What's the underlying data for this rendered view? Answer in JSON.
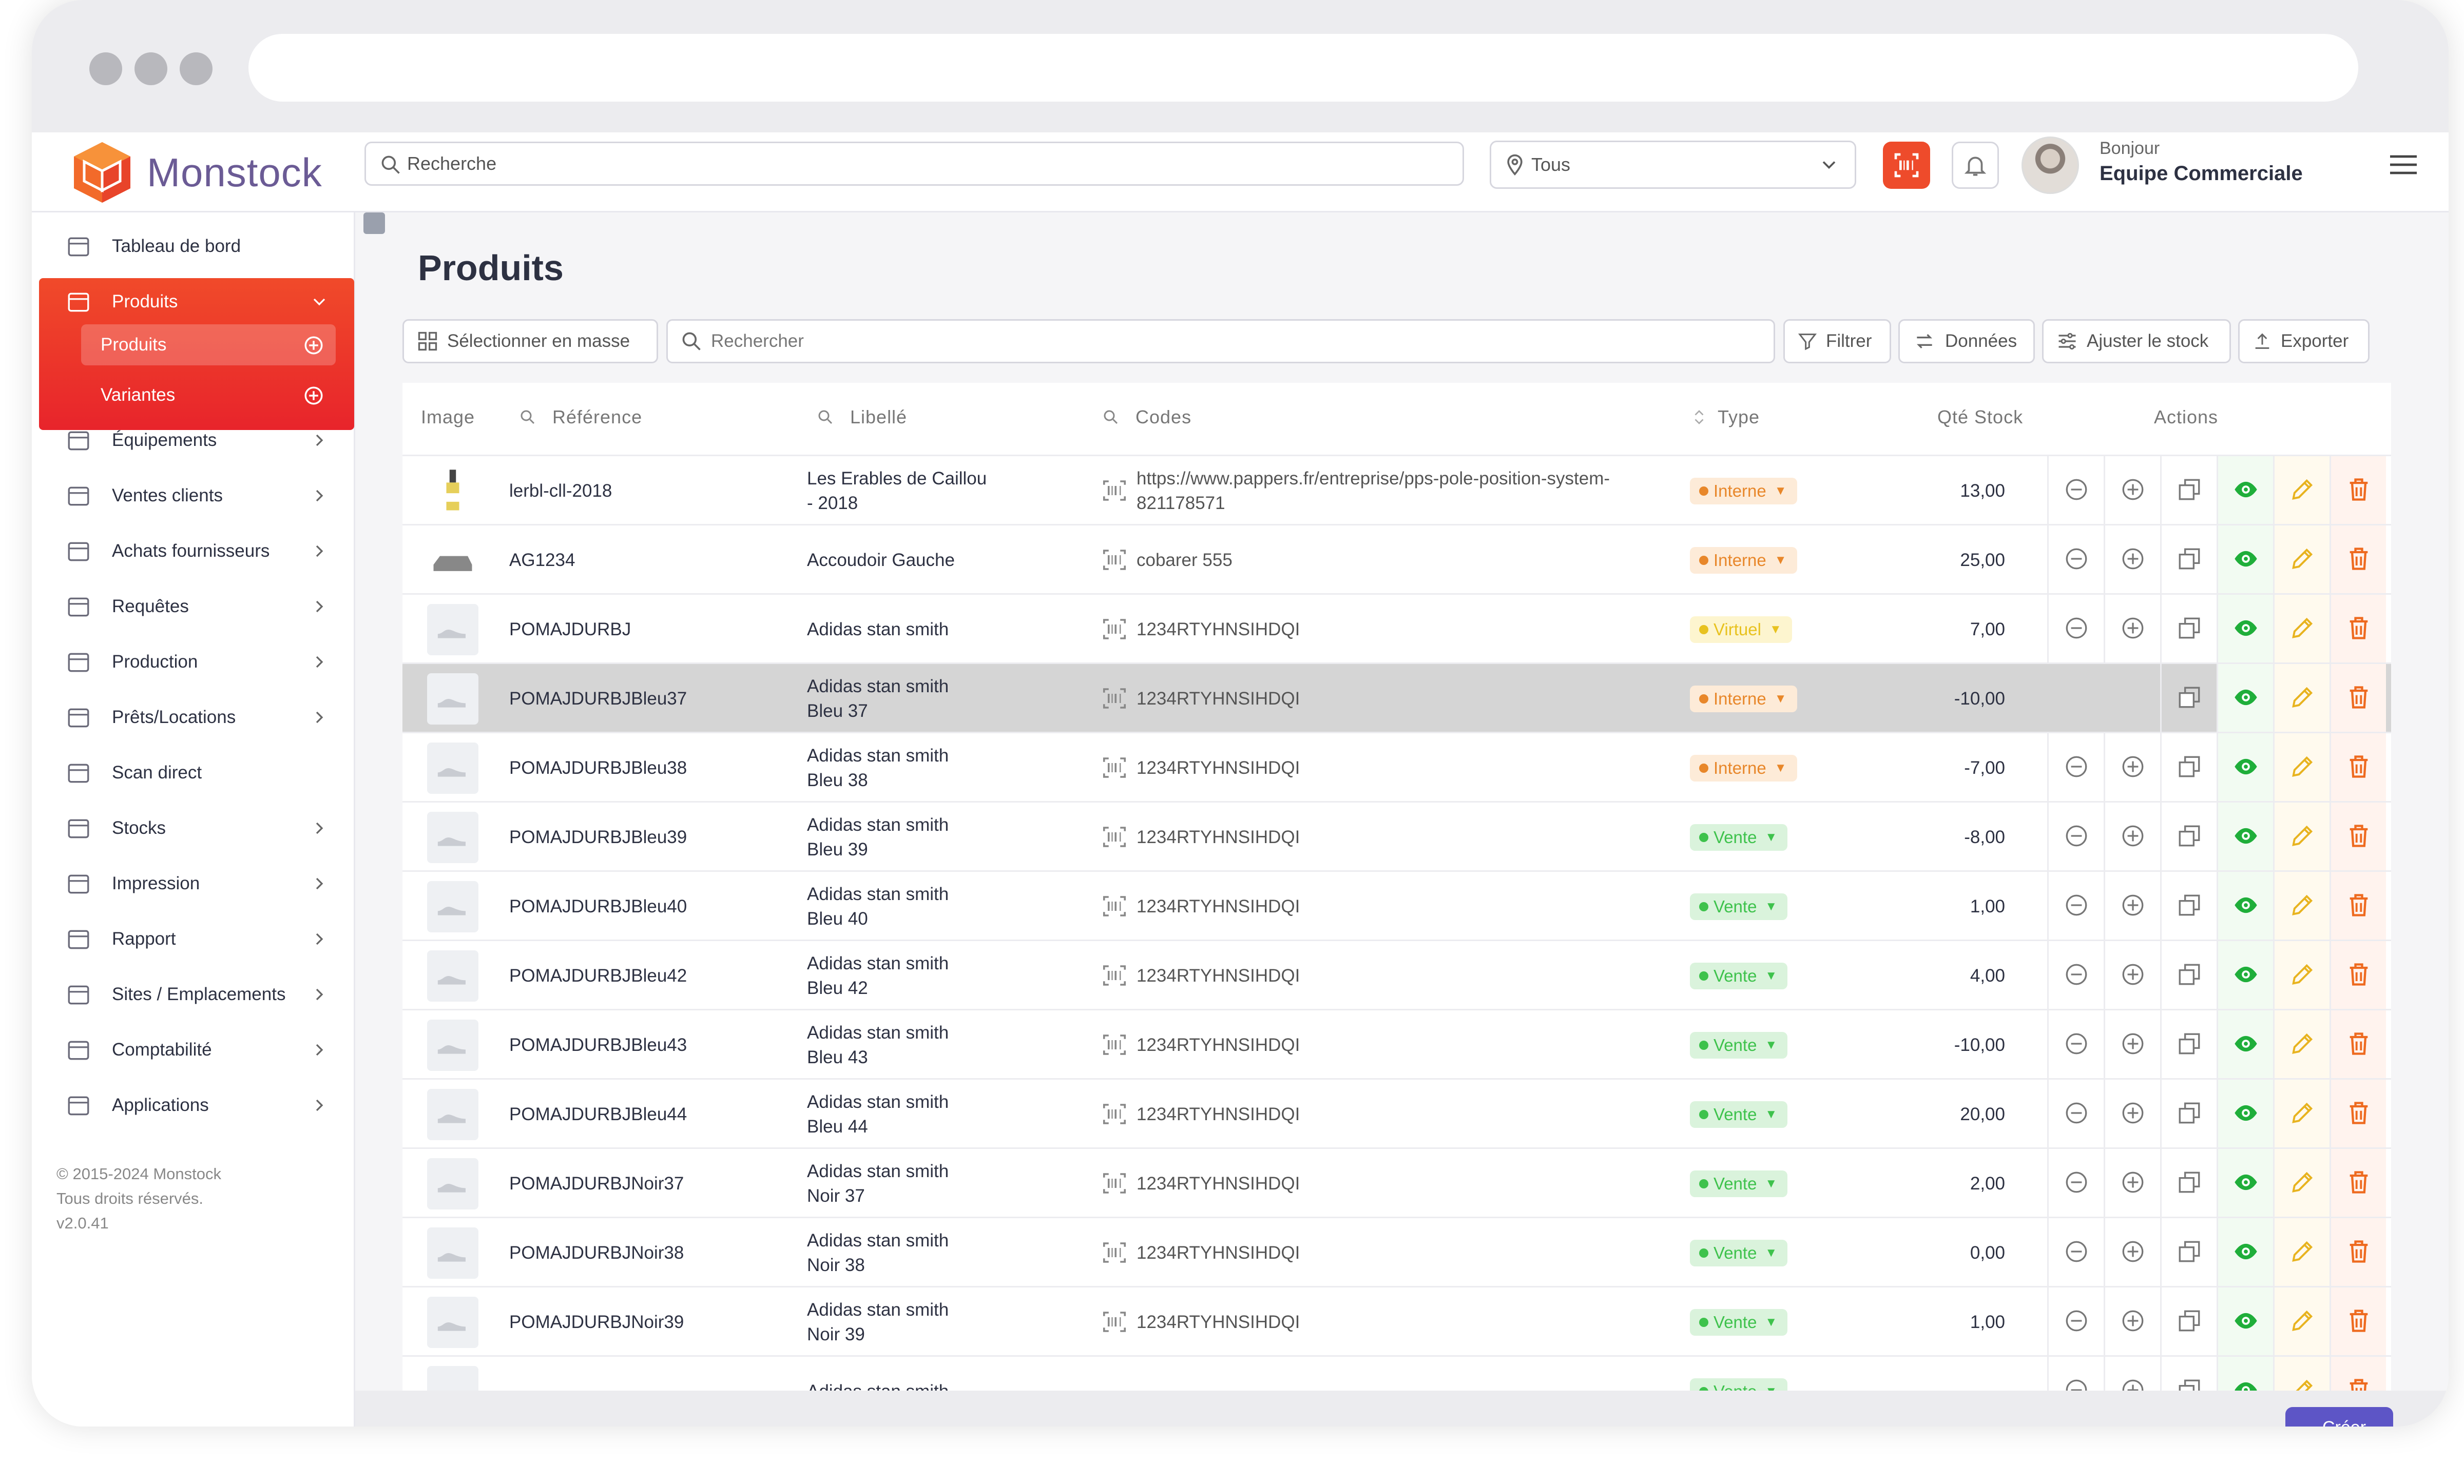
{
  "app": {
    "name": "Monstock"
  },
  "header": {
    "search_placeholder": "Recherche",
    "location_value": "Tous",
    "greeting": "Bonjour",
    "user_name": "Equipe Commerciale"
  },
  "sidebar": {
    "items": [
      {
        "label": "Tableau de bord",
        "icon": "dashboard-icon"
      },
      {
        "label": "Produits",
        "icon": "box-icon"
      },
      {
        "label": "Équipements",
        "icon": "tools-icon"
      },
      {
        "label": "Ventes clients",
        "icon": "sales-icon"
      },
      {
        "label": "Achats fournisseurs",
        "icon": "purchase-icon"
      },
      {
        "label": "Requêtes",
        "icon": "request-icon"
      },
      {
        "label": "Production",
        "icon": "production-icon"
      },
      {
        "label": "Prêts/Locations",
        "icon": "location-icon"
      },
      {
        "label": "Scan direct",
        "icon": "scan-icon"
      },
      {
        "label": "Stocks",
        "icon": "warehouse-icon"
      },
      {
        "label": "Impression",
        "icon": "tag-icon"
      },
      {
        "label": "Rapport",
        "icon": "report-icon"
      },
      {
        "label": "Sites / Emplacements",
        "icon": "site-icon"
      },
      {
        "label": "Comptabilité",
        "icon": "accounting-icon"
      },
      {
        "label": "Applications",
        "icon": "apps-icon"
      }
    ],
    "subitems": [
      {
        "label": "Produits"
      },
      {
        "label": "Variantes"
      }
    ],
    "copyright": [
      "© 2015-2024 Monstock",
      "Tous droits réservés.",
      "v2.0.41"
    ]
  },
  "main": {
    "title": "Produits",
    "toolbar": {
      "select_mass": "Sélectionner en masse",
      "search_placeholder": "Rechercher",
      "filter": "Filtrer",
      "data": "Données",
      "adjust": "Ajuster le stock",
      "export": "Exporter"
    },
    "columns": {
      "image": "Image",
      "reference": "Référence",
      "libelle": "Libellé",
      "codes": "Codes",
      "type": "Type",
      "qty": "Qté Stock",
      "actions": "Actions"
    },
    "rows": [
      {
        "ref": "lerbl-cll-2018",
        "lib1": "Les Erables de Caillou",
        "lib2": "- 2018",
        "code1": "https://www.pappers.fr/entreprise/pps-pole-position-system-",
        "code2": "821178571",
        "type": "Interne",
        "qty": "13,00"
      },
      {
        "ref": "AG1234",
        "lib1": "Accoudoir Gauche",
        "lib2": "",
        "code1": "cobarer 555",
        "code2": "",
        "type": "Interne",
        "qty": "25,00"
      },
      {
        "ref": "POMAJDURBJ",
        "lib1": "Adidas stan smith",
        "lib2": "",
        "code1": "1234RTYHNSIHDQI",
        "code2": "",
        "type": "Virtuel",
        "qty": "7,00"
      },
      {
        "ref": "POMAJDURBJBleu37",
        "lib1": "Adidas stan smith",
        "lib2": "Bleu 37",
        "code1": "1234RTYHNSIHDQI",
        "code2": "",
        "type": "Interne",
        "qty": "-10,00"
      },
      {
        "ref": "POMAJDURBJBleu38",
        "lib1": "Adidas stan smith",
        "lib2": "Bleu 38",
        "code1": "1234RTYHNSIHDQI",
        "code2": "",
        "type": "Interne",
        "qty": "-7,00"
      },
      {
        "ref": "POMAJDURBJBleu39",
        "lib1": "Adidas stan smith",
        "lib2": "Bleu 39",
        "code1": "1234RTYHNSIHDQI",
        "code2": "",
        "type": "Vente",
        "qty": "-8,00"
      },
      {
        "ref": "POMAJDURBJBleu40",
        "lib1": "Adidas stan smith",
        "lib2": "Bleu 40",
        "code1": "1234RTYHNSIHDQI",
        "code2": "",
        "type": "Vente",
        "qty": "1,00"
      },
      {
        "ref": "POMAJDURBJBleu42",
        "lib1": "Adidas stan smith",
        "lib2": "Bleu 42",
        "code1": "1234RTYHNSIHDQI",
        "code2": "",
        "type": "Vente",
        "qty": "4,00"
      },
      {
        "ref": "POMAJDURBJBleu43",
        "lib1": "Adidas stan smith",
        "lib2": "Bleu 43",
        "code1": "1234RTYHNSIHDQI",
        "code2": "",
        "type": "Vente",
        "qty": "-10,00"
      },
      {
        "ref": "POMAJDURBJBleu44",
        "lib1": "Adidas stan smith",
        "lib2": "Bleu 44",
        "code1": "1234RTYHNSIHDQI",
        "code2": "",
        "type": "Vente",
        "qty": "20,00"
      },
      {
        "ref": "POMAJDURBJNoir37",
        "lib1": "Adidas stan smith",
        "lib2": "Noir 37",
        "code1": "1234RTYHNSIHDQI",
        "code2": "",
        "type": "Vente",
        "qty": "2,00"
      },
      {
        "ref": "POMAJDURBJNoir38",
        "lib1": "Adidas stan smith",
        "lib2": "Noir 38",
        "code1": "1234RTYHNSIHDQI",
        "code2": "",
        "type": "Vente",
        "qty": "0,00"
      },
      {
        "ref": "POMAJDURBJNoir39",
        "lib1": "Adidas stan smith",
        "lib2": "Noir 39",
        "code1": "1234RTYHNSIHDQI",
        "code2": "",
        "type": "Vente",
        "qty": "1,00"
      },
      {
        "ref": "",
        "lib1": "Adidas stan smith",
        "lib2": "",
        "code1": "",
        "code2": "",
        "type": "Vente",
        "qty": ""
      }
    ],
    "create_label": "Créer"
  },
  "colors": {
    "accent": "#ee4b2b",
    "interne": "#e8872a",
    "virtuel": "#e8c21f",
    "vente": "#3ec24c",
    "view": "#1fae3a",
    "edit": "#e8b31f",
    "delete": "#ee6a1f",
    "primary": "#5d55c6"
  }
}
